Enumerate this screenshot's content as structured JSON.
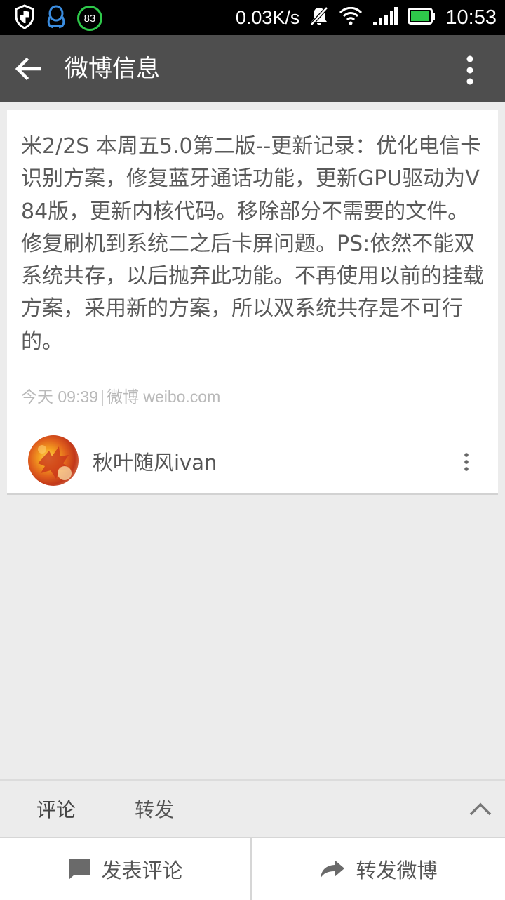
{
  "status_bar": {
    "battery_badge": "83",
    "net_speed": "0.03K/s",
    "time": "10:53"
  },
  "title_bar": {
    "title": "微博信息"
  },
  "post": {
    "text": "米2/2S 本周五5.0第二版--更新记录：优化电信卡识别方案，修复蓝牙通话功能，更新GPU驱动为V84版，更新内核代码。移除部分不需要的文件。修复刷机到系统二之后卡屏问题。PS:依然不能双系统共存，以后抛弃此功能。不再使用以前的挂载方案，采用新的方案，所以双系统共存是不可行的。",
    "time": "今天 09:39",
    "separator": "|",
    "source": "微博 weibo.com",
    "author": "秋叶随风ivan"
  },
  "tabs": {
    "comments": "评论",
    "reposts": "转发"
  },
  "actions": {
    "comment": "发表评论",
    "repost": "转发微博"
  }
}
